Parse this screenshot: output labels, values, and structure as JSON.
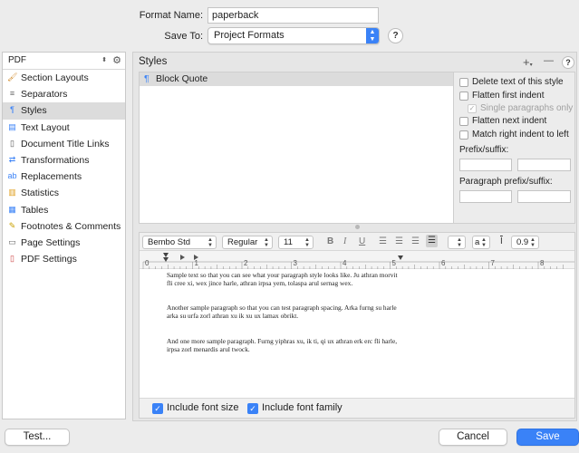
{
  "header": {
    "format_name_label": "Format Name:",
    "format_name_value": "paperback",
    "save_to_label": "Save To:",
    "save_to_value": "Project Formats",
    "help": "?"
  },
  "sidebar": {
    "format_select": "PDF",
    "items": [
      {
        "label": "Section Layouts",
        "icon": "brush-icon"
      },
      {
        "label": "Separators",
        "icon": "separator-icon"
      },
      {
        "label": "Styles",
        "icon": "styles-icon",
        "selected": true
      },
      {
        "label": "Text Layout",
        "icon": "text-layout-icon"
      },
      {
        "label": "Document Title Links",
        "icon": "document-icon"
      },
      {
        "label": "Transformations",
        "icon": "transform-icon"
      },
      {
        "label": "Replacements",
        "icon": "replace-icon"
      },
      {
        "label": "Statistics",
        "icon": "chart-icon"
      },
      {
        "label": "Tables",
        "icon": "table-icon"
      },
      {
        "label": "Footnotes & Comments",
        "icon": "footnote-icon"
      },
      {
        "label": "Page Settings",
        "icon": "page-icon"
      },
      {
        "label": "PDF Settings",
        "icon": "pdf-icon"
      }
    ]
  },
  "styles": {
    "title": "Styles",
    "add": "+",
    "remove": "—",
    "help": "?",
    "list": [
      {
        "mark": "¶",
        "name": "Block Quote"
      }
    ]
  },
  "options": {
    "delete_text": "Delete text of this style",
    "flatten_first": "Flatten first indent",
    "single_para": "Single paragraphs only",
    "flatten_next": "Flatten next indent",
    "match_right": "Match right indent to left",
    "prefix_label": "Prefix/suffix:",
    "para_prefix_label": "Paragraph prefix/suffix:"
  },
  "toolbar": {
    "font": "Bembo Std",
    "weight": "Regular",
    "size": "11",
    "bold": "B",
    "italic": "I",
    "underline": "U",
    "spacing_marker": "a",
    "line_height": "0.9"
  },
  "ruler": {
    "ticks": [
      "0",
      "1",
      "2",
      "3",
      "4",
      "5",
      "6",
      "7",
      "8"
    ]
  },
  "sample": {
    "p1": "Sample text so that you can see what your paragraph style looks like. Ju athran morvit fli cree xi, wex jince harle, athran irpsa yem, tolaspa arul sernag wex.",
    "p2": "Another sample paragraph so that you can test paragraph spacing. Arka furng su harle arka su urfa zorl athran xu ik xu ux lamax obrikt.",
    "p3": "And one more sample paragraph. Furng yiphras xu, ik ti, qi ux athran erk erc fli harle, irpsa zorl menardis arul twock."
  },
  "bottom": {
    "include_font_size": "Include font size",
    "include_font_family": "Include font family",
    "test": "Test...",
    "cancel": "Cancel",
    "save": "Save"
  },
  "colors": {
    "accent": "#3a82f7"
  }
}
